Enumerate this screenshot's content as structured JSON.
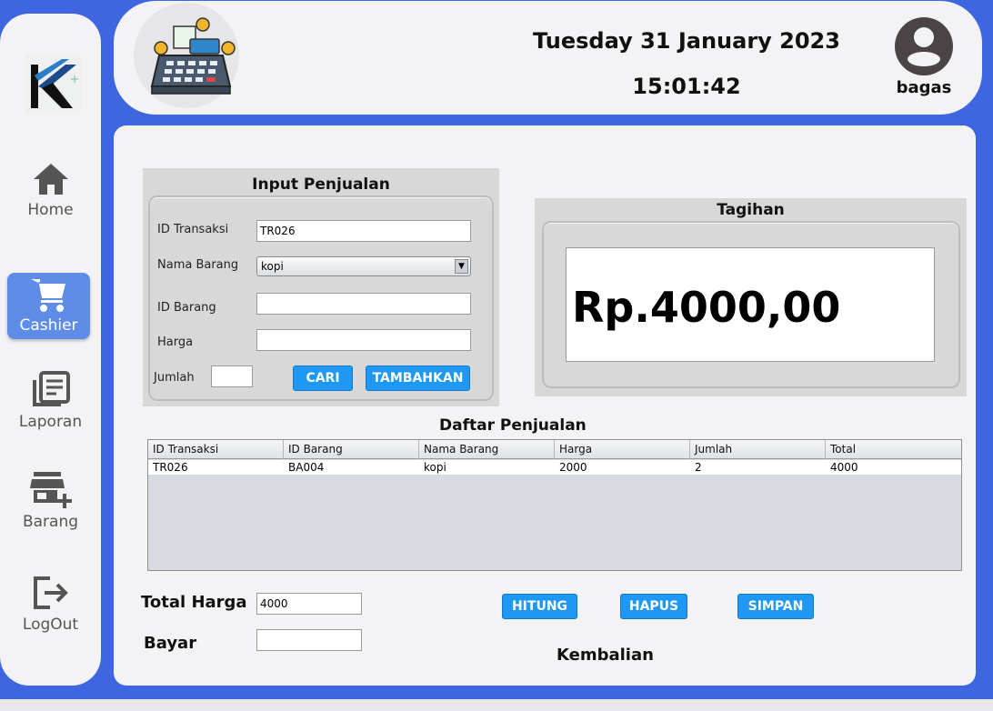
{
  "header": {
    "date": "Tuesday 31 January 2023",
    "time": "15:01:42",
    "username": "bagas"
  },
  "sidebar": {
    "items": [
      {
        "label": "Home",
        "icon": "home-icon"
      },
      {
        "label": "Cashier",
        "icon": "cart-icon",
        "active": true
      },
      {
        "label": "Laporan",
        "icon": "report-icon"
      },
      {
        "label": "Barang",
        "icon": "store-add-icon"
      },
      {
        "label": "LogOut",
        "icon": "logout-icon"
      }
    ]
  },
  "input_penjualan": {
    "title": "Input Penjualan",
    "id_transaksi_label": "ID Transaksi",
    "id_transaksi_value": "TR026",
    "nama_barang_label": "Nama Barang",
    "nama_barang_value": "kopi",
    "id_barang_label": "ID Barang",
    "id_barang_value": "",
    "harga_label": "Harga",
    "harga_value": "",
    "jumlah_label": "Jumlah",
    "jumlah_value": "",
    "cari_label": "CARI",
    "tambahkan_label": "TAMBAHKAN"
  },
  "tagihan": {
    "title": "Tagihan",
    "amount": "Rp.4000,00"
  },
  "daftar_penjualan": {
    "title": "Daftar Penjualan",
    "columns": [
      "ID Transaksi",
      "ID Barang",
      "Nama Barang",
      "Harga",
      "Jumlah",
      "Total"
    ],
    "rows": [
      [
        "TR026",
        "BA004",
        "kopi",
        "2000",
        "2",
        "4000"
      ]
    ]
  },
  "footer": {
    "total_harga_label": "Total Harga",
    "total_harga_value": "4000",
    "bayar_label": "Bayar",
    "bayar_value": "",
    "hitung_label": "HITUNG",
    "hapus_label": "HAPUS",
    "simpan_label": "SIMPAN",
    "kembalian_label": "Kembalian"
  },
  "colors": {
    "background": "#3d66e0",
    "panel": "#f3f2f4",
    "button": "#1e98f2",
    "active_nav": "#5f8ce6"
  }
}
